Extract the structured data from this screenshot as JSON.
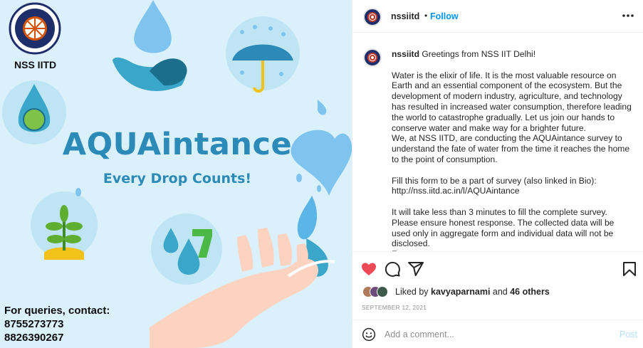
{
  "poster": {
    "org_name": "NSS IITD",
    "emblem_text": "राष्ट्रीय सेवा योजना · NATIONAL SERVICE SCHEME",
    "headline": "AQUAintance",
    "tagline": "Every Drop Counts!",
    "contact_heading": "For queries, contact:",
    "phones": [
      "8755273773",
      "8826390267"
    ]
  },
  "header": {
    "username": "nssiitd",
    "dot": "•",
    "follow_label": "Follow",
    "more_icon": "more-horizontal-icon"
  },
  "caption": {
    "username": "nssiitd",
    "greeting": "Greetings from NSS IIT Delhi!",
    "paragraphs": [
      "Water is the elixir of life. It is the most valuable resource on Earth and an essential component of the ecosystem. But the development of modern industry, agriculture, and technology has resulted in increased water consumption, therefore leading the world to catastrophe gradually. Let us join our hands to conserve water and make way for a brighter future.\nWe, at NSS IITD, are conducting the AQUAintance survey to understand the fate of water from the time it reaches the home to the point of consumption.",
      "Fill this form to be a part of survey (also linked in Bio):\nhttp://nss.iitd.ac.in/l/AQUAintance",
      "It will take less than 3 minutes to fill the complete survey. Please ensure honest response. The collected data will be used only in aggregate form and individual data will not be disclosed.\nFor any query, contact:"
    ]
  },
  "actions": {
    "like_icon": "heart-filled-icon",
    "comment_icon": "comment-icon",
    "share_icon": "share-icon",
    "save_icon": "bookmark-icon",
    "like_color": "#ed4956"
  },
  "likes": {
    "prefix": "Liked by ",
    "user": "kavyaparnami",
    "middle": " and ",
    "others": "46 others"
  },
  "date": "SEPTEMBER 12, 2021",
  "comment_bar": {
    "emoji_icon": "emoji-smile-icon",
    "placeholder": "Add a comment...",
    "post_label": "Post"
  },
  "colors": {
    "accent": "#0095f6",
    "poster_bg": "#daf1fb",
    "poster_title": "#2b8ab8"
  }
}
